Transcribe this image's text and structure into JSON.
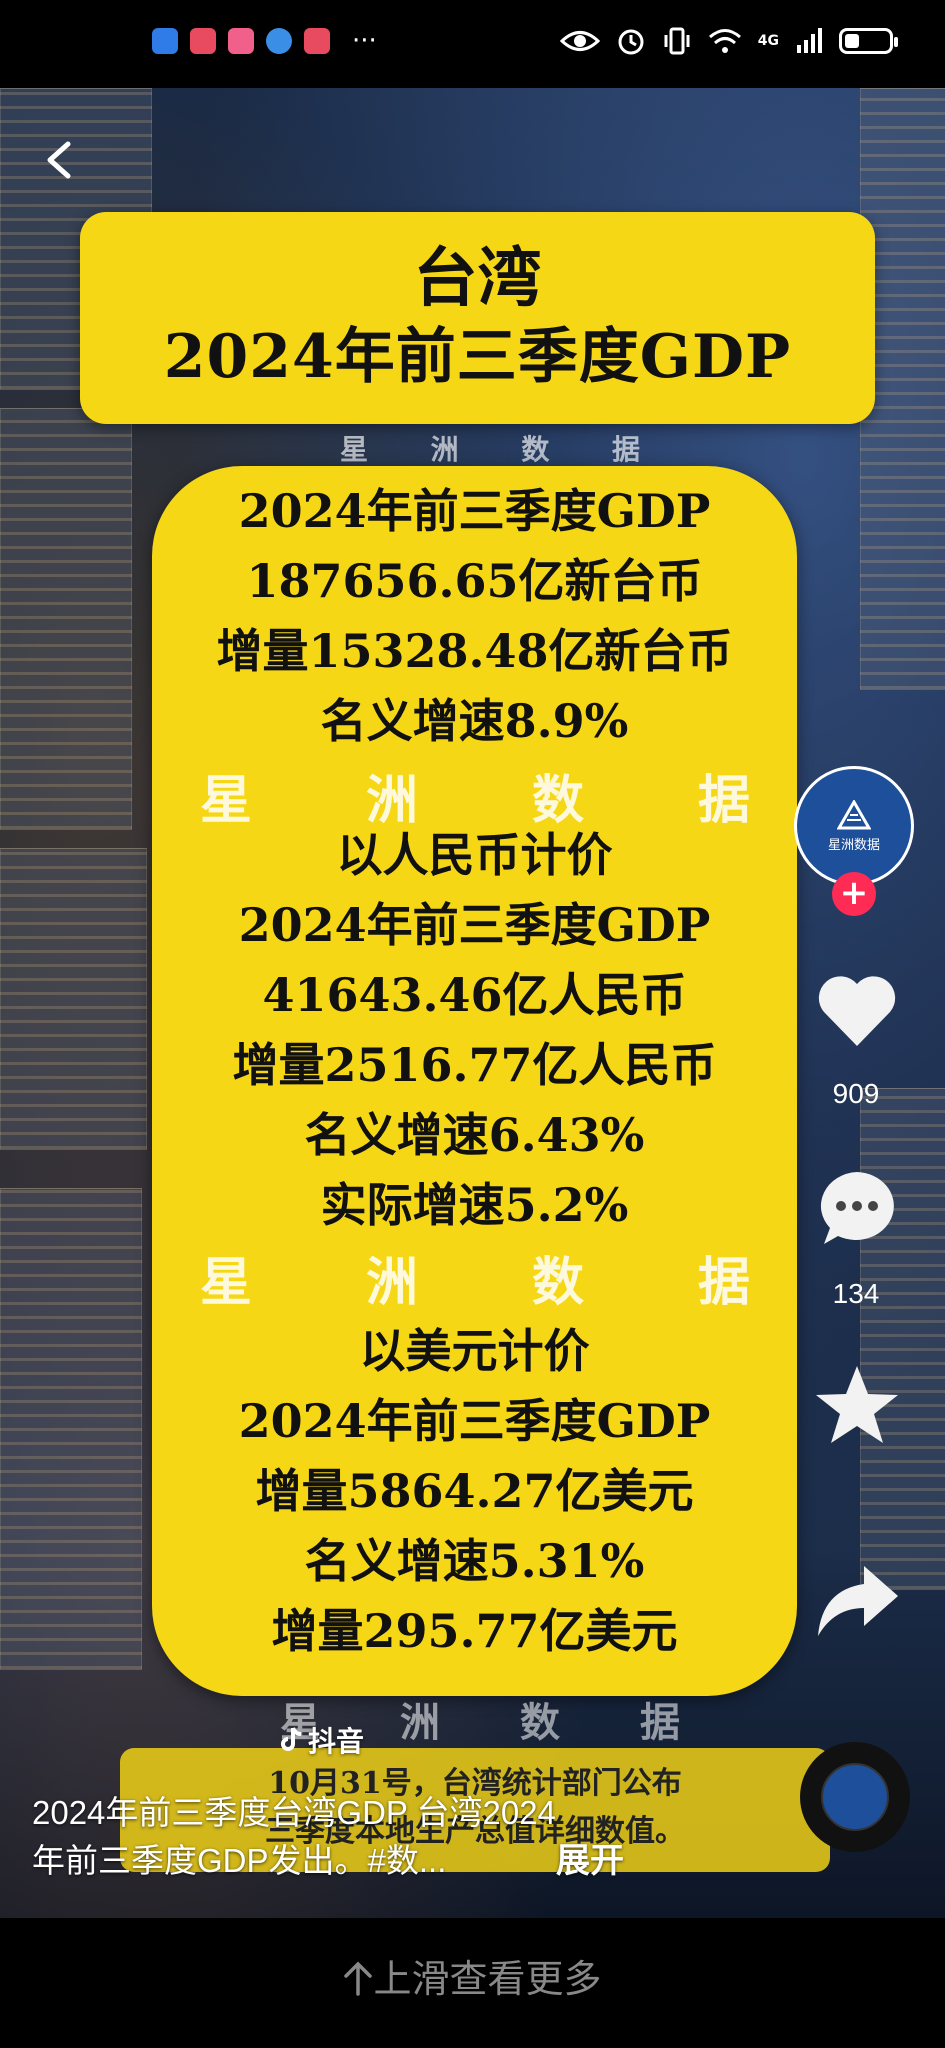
{
  "status_bar": {
    "more": "···",
    "network": "4G"
  },
  "title": {
    "line1": "台湾",
    "line2": "2024年前三季度GDP"
  },
  "watermark": [
    "星",
    "洲",
    "数",
    "据"
  ],
  "card": {
    "ntd": [
      "2024年前三季度GDP",
      "187656.65亿新台币",
      "增量15328.48亿新台币",
      "名义增速8.9%"
    ],
    "rmb": [
      "以人民币计价",
      "2024年前三季度GDP",
      "41643.46亿人民币",
      "增量2516.77亿人民币",
      "名义增速6.43%",
      "实际增速5.2%"
    ],
    "usd": [
      "以美元计价",
      "2024年前三季度GDP",
      "增量5864.27亿美元",
      "名义增速5.31%",
      "增量295.77亿美元"
    ]
  },
  "doc_strip": [
    "10月31号，台湾统计部门公布",
    "三季度本地生产总值详细数值。"
  ],
  "logo_tag": "抖音",
  "avatar_label": "星洲数据",
  "actions": {
    "likes": "909",
    "comments": "134"
  },
  "caption": {
    "line1": "2024年前三季度台湾GDP 台湾2024",
    "line2": "年前三季度GDP发出。#数...",
    "expand": "展开"
  },
  "swipe_hint": "上滑查看更多",
  "colors": {
    "banner_yellow": "#f6d716",
    "follow_red": "#fe2c55",
    "avatar_blue": "#1d4f9b"
  }
}
